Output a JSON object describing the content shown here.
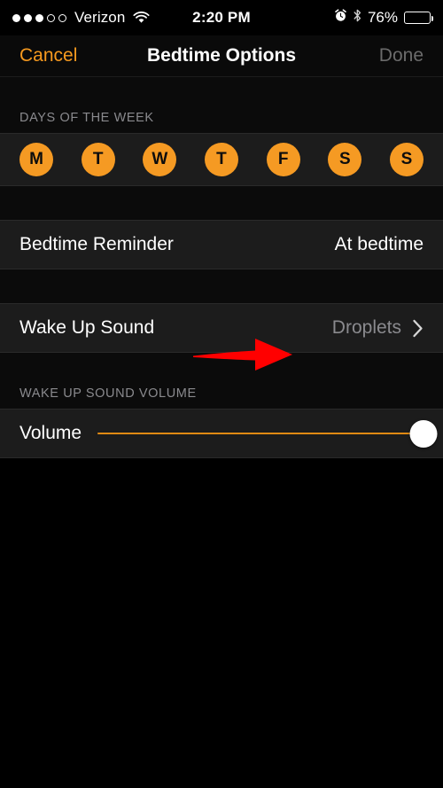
{
  "status_bar": {
    "signal_dots_filled": 3,
    "signal_dots_total": 5,
    "carrier": "Verizon",
    "wifi_icon": "wifi-icon",
    "time": "2:20 PM",
    "alarm_icon": "alarm-clock-icon",
    "bluetooth_icon": "bluetooth-icon",
    "battery_percent": "76%",
    "battery_level": 76,
    "battery_color": "#FFCC00"
  },
  "nav_bar": {
    "cancel_label": "Cancel",
    "title": "Bedtime Options",
    "done_label": "Done",
    "cancel_color": "#F79A1F",
    "done_color": "#6B6B6B"
  },
  "sections": {
    "days": {
      "header": "DAYS OF THE WEEK",
      "days": [
        {
          "letter": "M",
          "name": "monday",
          "selected": true
        },
        {
          "letter": "T",
          "name": "tuesday",
          "selected": true
        },
        {
          "letter": "W",
          "name": "wednesday",
          "selected": true
        },
        {
          "letter": "T",
          "name": "thursday",
          "selected": true
        },
        {
          "letter": "F",
          "name": "friday",
          "selected": true
        },
        {
          "letter": "S",
          "name": "saturday",
          "selected": true
        },
        {
          "letter": "S",
          "name": "sunday",
          "selected": true
        }
      ],
      "selected_color": "#F59A23"
    },
    "reminder": {
      "label": "Bedtime Reminder",
      "value": "At bedtime"
    },
    "wake_up_sound": {
      "label": "Wake Up Sound",
      "value": "Droplets",
      "chevron_icon": "chevron-right-icon"
    },
    "volume": {
      "header": "WAKE UP SOUND VOLUME",
      "label": "Volume",
      "value_percent": 100,
      "track_color": "#E08A13",
      "thumb_color": "#FFFFFF"
    }
  },
  "annotation": {
    "arrow_icon": "red-arrow-icon",
    "arrow_color": "#FF0000",
    "points_to": "Wake Up Sound"
  }
}
